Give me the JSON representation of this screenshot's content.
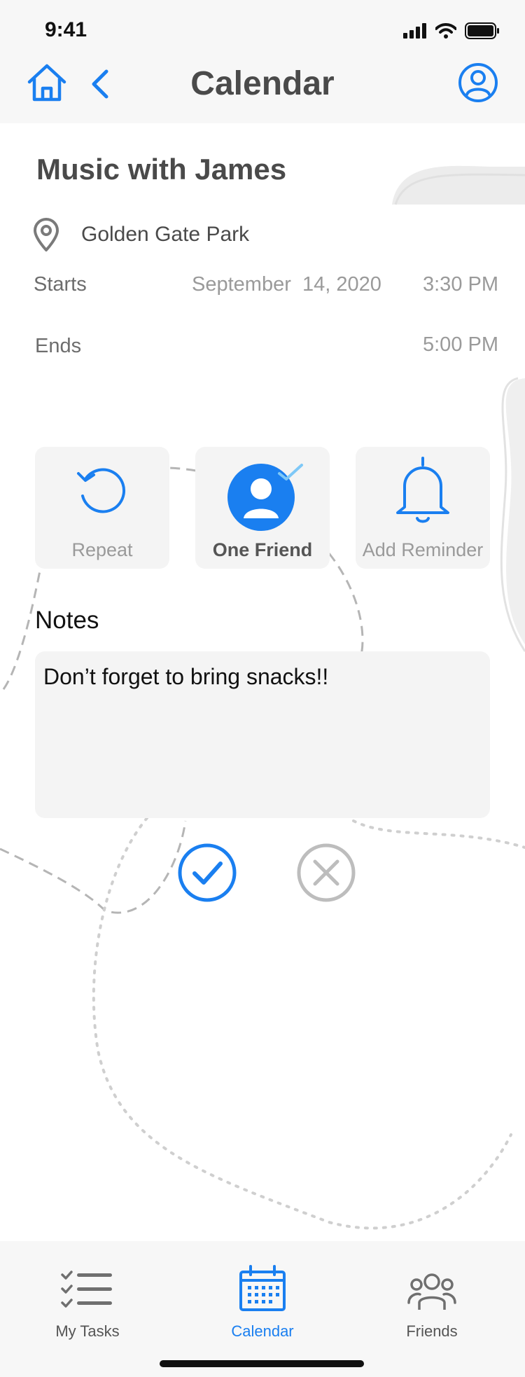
{
  "status_bar": {
    "time": "9:41"
  },
  "header": {
    "title": "Calendar"
  },
  "event": {
    "title": "Music with James",
    "location": "Golden Gate Park",
    "starts_label": "Starts",
    "start_date": "September  14, 2020",
    "start_time": "3:30 PM",
    "ends_label": "Ends",
    "end_time": "5:00 PM"
  },
  "options": [
    {
      "label": "Repeat",
      "icon": "repeat-icon"
    },
    {
      "label": "One Friend",
      "icon": "friend-avatar-icon",
      "selected": true
    },
    {
      "label": "Add Reminder",
      "icon": "bell-icon"
    }
  ],
  "notes": {
    "label": "Notes",
    "value": "Don’t forget to bring snacks!!"
  },
  "tabs": [
    {
      "label": "My Tasks",
      "icon": "task-list-icon"
    },
    {
      "label": "Calendar",
      "icon": "calendar-icon",
      "active": true
    },
    {
      "label": "Friends",
      "icon": "friends-icon"
    }
  ],
  "colors": {
    "accent": "#1a7ff0",
    "muted": "#9a9a9a",
    "tile_bg": "#f4f4f4"
  }
}
